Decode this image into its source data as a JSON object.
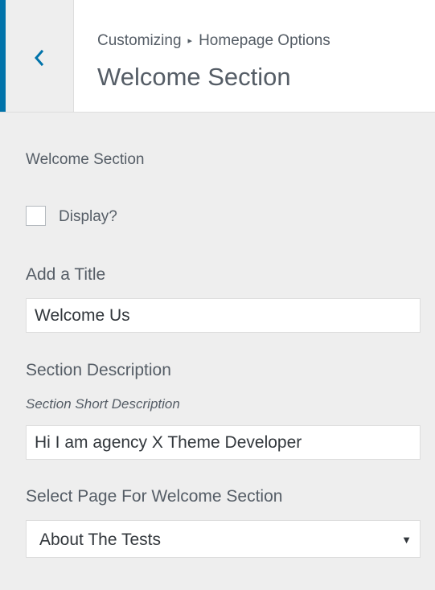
{
  "header": {
    "breadcrumb_parent": "Customizing",
    "breadcrumb_separator": "▸",
    "breadcrumb_current": "Homepage Options",
    "title": "Welcome Section",
    "back_icon": "chevron-left-icon",
    "accent_color": "#0073aa"
  },
  "section": {
    "label": "Welcome Section",
    "display_checkbox": {
      "label": "Display?",
      "checked": false
    }
  },
  "fields": {
    "title": {
      "label": "Add a Title",
      "value": "Welcome Us"
    },
    "description": {
      "label": "Section Description",
      "hint": "Section Short Description",
      "value": "Hi I am agency X Theme Developer"
    },
    "page_select": {
      "label": "Select Page For Welcome Section",
      "selected": "About The Tests",
      "arrow": "▼"
    }
  }
}
